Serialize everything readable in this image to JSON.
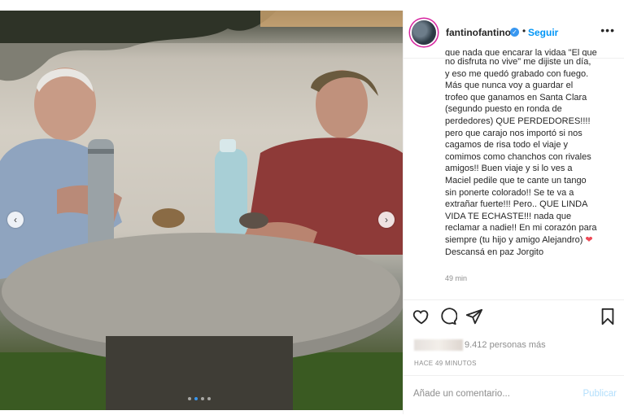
{
  "post": {
    "username": "fantinofantino",
    "follow_label": "Seguir",
    "bullet": "•",
    "more_label": "•••",
    "caption_cut": "que nada que encarar la vidaa \"El que",
    "caption_lines": [
      "no disfruta no vive\" me dijiste un día,",
      "y eso me quedó grabado con fuego.",
      "Más que nunca voy a guardar el",
      "trofeo que ganamos en Santa Clara",
      "(segundo puesto en ronda de",
      "perdedores) QUE PERDEDORES!!!!",
      "pero que carajo nos importó si nos",
      "cagamos de risa todo el viaje y",
      "comimos como chanchos con rivales",
      "amigos!! Buen viaje y si lo ves a",
      "Maciel pedile que te cante un tango",
      "sin ponerte colorado!! Se te va a",
      "extrañar fuerte!!! Pero.. QUE LINDA",
      "VIDA TE ECHASTE!!! nada que",
      "reclamar a nadie!! En mi corazón para",
      "siempre (tu hijo y amigo Alejandro)",
      "Descansá en paz Jorgito"
    ],
    "heart_emoji": "❤",
    "caption_time": "49 min",
    "likes_text": "9.412 personas más",
    "posted_ago": "HACE 49 MINUTOS",
    "comment_placeholder": "Añade un comentario...",
    "publish_label": "Publicar",
    "carousel": {
      "dots": 4,
      "active_index": 1
    },
    "prev_arrow": "‹",
    "next_arrow": "›",
    "verified_mark": "✓"
  },
  "colors": {
    "link_blue": "#0095f6",
    "publish_disabled": "#b2dffc",
    "heart_red": "#ed4956"
  }
}
